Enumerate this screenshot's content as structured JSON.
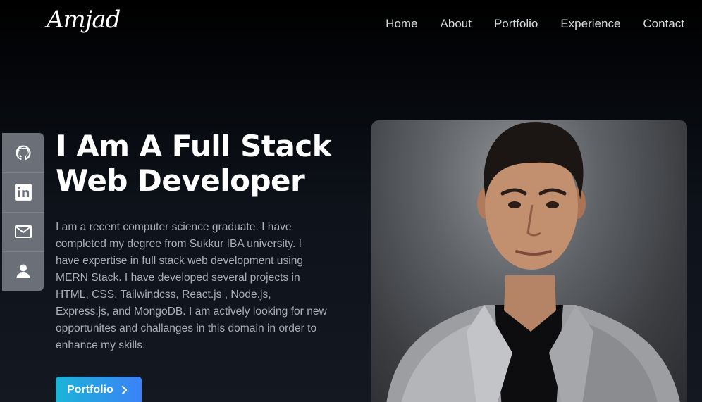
{
  "header": {
    "logo": "Amjad",
    "nav": [
      "Home",
      "About",
      "Portfolio",
      "Experience",
      "Contact"
    ]
  },
  "social": {
    "icons": [
      "github-icon",
      "linkedin-icon",
      "mail-icon",
      "user-icon"
    ]
  },
  "hero": {
    "title_line1": "I Am A Full Stack",
    "title_line2": "Web Developer",
    "description": "I am a recent computer science graduate. I have completed my degree from Sukkur IBA university. I have expertise in full stack web development using MERN Stack. I have developed several projects in HTML, CSS, Tailwindcss, React.js , Node.js, Express.js, and MongoDB. I am actively looking for new opportunites and challanges in this domain in order to enhance my skills.",
    "button_label": "Portfolio"
  },
  "colors": {
    "background": "#0e121a",
    "social_bar": "#6a6f78",
    "button_start": "#1ab4d8",
    "button_end": "#3b82f6"
  }
}
